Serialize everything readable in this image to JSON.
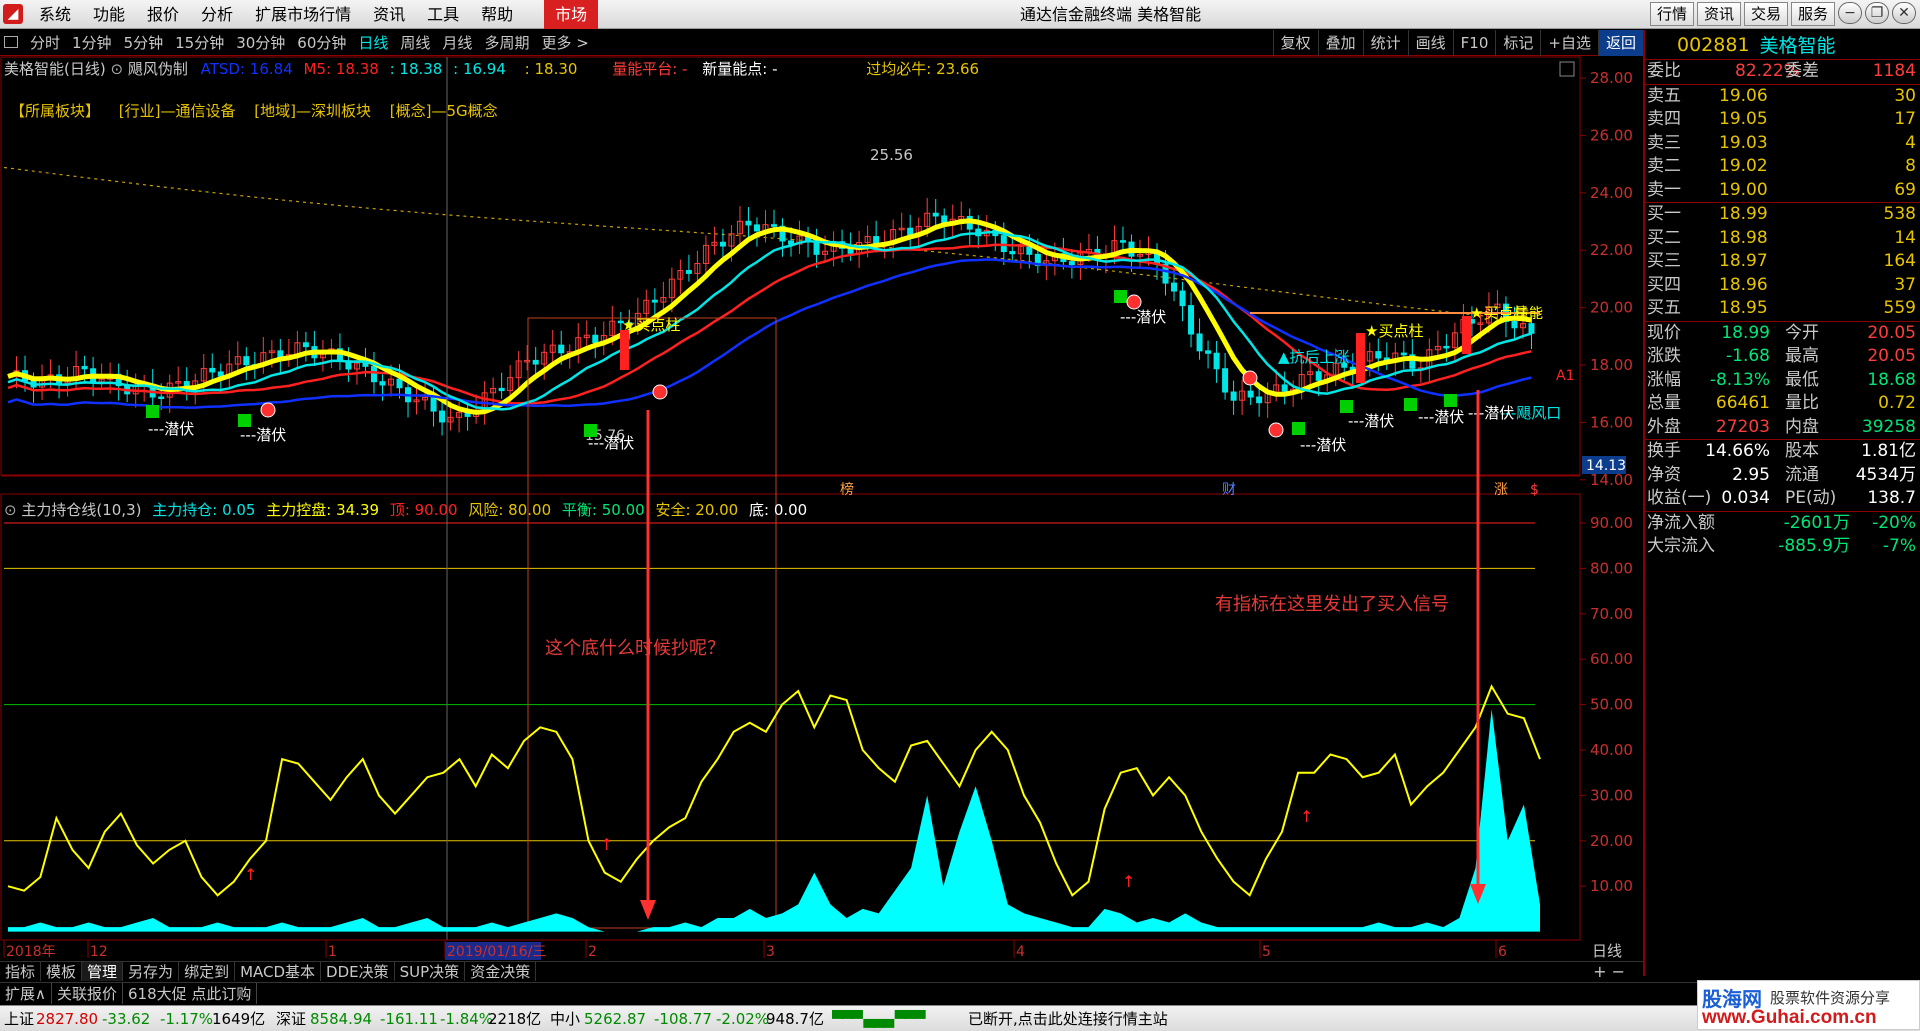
{
  "titlebar": {
    "menu": [
      "系统",
      "功能",
      "报价",
      "分析",
      "扩展市场行情",
      "资讯",
      "工具",
      "帮助"
    ],
    "active_menu": "市场",
    "window_title": "通达信金融终端  美格智能",
    "window_buttons": [
      "行情",
      "资讯",
      "交易",
      "服务"
    ]
  },
  "period_bar": {
    "periods": [
      "分时",
      "1分钟",
      "5分钟",
      "15分钟",
      "30分钟",
      "60分钟",
      "日线",
      "周线",
      "月线",
      "多周期",
      "更多 >"
    ],
    "selected": "日线",
    "tools": [
      "复权",
      "叠加",
      "统计",
      "画线",
      "F10",
      "标记",
      "+自选",
      "返回"
    ]
  },
  "main_header": {
    "name": "美格智能(日线)",
    "indicator": "飓风伪制",
    "atsd": "ATSD: 16.84",
    "m5": "M5: 18.38",
    "v1": ": 18.38",
    "v2": ": 16.94",
    "v3": ": 18.30",
    "platform": "量能平台: -",
    "new_point": "新量能点: -",
    "guojun": "过均必牛: 23.66"
  },
  "sectors": [
    "【所属板块】",
    "[行业]—通信设备",
    "[地域]—深圳板块",
    "[概念]—5G概念"
  ],
  "price_axis": [
    "28.00",
    "26.00",
    "24.00",
    "22.00",
    "20.00",
    "18.00",
    "16.00",
    "14.00"
  ],
  "price_marker": "14.13",
  "indicator_header": {
    "name": "主力持仓线(10,3)",
    "hold": "主力持仓: 0.05",
    "control": "主力控盘: 34.39",
    "top": "顶: 90.00",
    "risk": "风险: 80.00",
    "balance": "平衡: 50.00",
    "safe": "安全: 20.00",
    "bottom": "底: 0.00"
  },
  "indicator_axis": [
    "90.00",
    "80.00",
    "70.00",
    "60.00",
    "50.00",
    "40.00",
    "30.00",
    "20.00",
    "10.00"
  ],
  "annotations": {
    "question": "这个底什么时候抄呢？",
    "signal": "有指标在这里发出了买入信号"
  },
  "chart_labels": {
    "peak": "25.56",
    "low": "15.76",
    "buy_column": "★买点柱",
    "resist_rise": "▲抗后上涨",
    "qianfu": "---潜伏",
    "hurricane": "---飓风口",
    "liangneng": "量能",
    "a1": "A1",
    "bang": "榜",
    "cai": "财",
    "zhang": "涨",
    "dollar": "$"
  },
  "x_axis": [
    "2018年",
    "12",
    "1",
    "2019/01/16/三",
    "2",
    "3",
    "4",
    "5",
    "6"
  ],
  "x_axis_right": "日线",
  "quote": {
    "code": "002881",
    "name": "美格智能",
    "weibi_label": "委比",
    "weibi": "82.22%",
    "weicha_label": "委差",
    "weicha": "1184",
    "asks": [
      {
        "label": "卖五",
        "price": "19.06",
        "vol": "30"
      },
      {
        "label": "卖四",
        "price": "19.05",
        "vol": "17"
      },
      {
        "label": "卖三",
        "price": "19.03",
        "vol": "4"
      },
      {
        "label": "卖二",
        "price": "19.02",
        "vol": "8"
      },
      {
        "label": "卖一",
        "price": "19.00",
        "vol": "69"
      }
    ],
    "bids": [
      {
        "label": "买一",
        "price": "18.99",
        "vol": "538"
      },
      {
        "label": "买二",
        "price": "18.98",
        "vol": "14"
      },
      {
        "label": "买三",
        "price": "18.97",
        "vol": "164"
      },
      {
        "label": "买四",
        "price": "18.96",
        "vol": "37"
      },
      {
        "label": "买五",
        "price": "18.95",
        "vol": "559"
      }
    ],
    "stats": [
      {
        "l1": "现价",
        "v1": "18.99",
        "c1": "green",
        "l2": "今开",
        "v2": "20.05",
        "c2": "red"
      },
      {
        "l1": "涨跌",
        "v1": "-1.68",
        "c1": "green",
        "l2": "最高",
        "v2": "20.05",
        "c2": "red"
      },
      {
        "l1": "涨幅",
        "v1": "-8.13%",
        "c1": "green",
        "l2": "最低",
        "v2": "18.68",
        "c2": "green"
      },
      {
        "l1": "总量",
        "v1": "66461",
        "c1": "yellow",
        "l2": "量比",
        "v2": "0.72",
        "c2": "yellow"
      },
      {
        "l1": "外盘",
        "v1": "27203",
        "c1": "red",
        "l2": "内盘",
        "v2": "39258",
        "c2": "green"
      }
    ],
    "stats2": [
      {
        "l1": "换手",
        "v1": "14.66%",
        "l2": "股本",
        "v2": "1.81亿"
      },
      {
        "l1": "净资",
        "v1": "2.95",
        "l2": "流通",
        "v2": "4534万"
      },
      {
        "l1": "收益(一)",
        "v1": "0.034",
        "l2": "PE(动)",
        "v2": "138.7"
      }
    ],
    "flows": [
      {
        "label": "净流入额",
        "v1": "-2601万",
        "v2": "-20%"
      },
      {
        "label": "大宗流入",
        "v1": "-885.9万",
        "v2": "-7%"
      }
    ]
  },
  "tabs": [
    "指标",
    "模板",
    "管理",
    "另存为",
    "绑定到",
    "MACD基本",
    "DDE决策",
    "SUP决策",
    "资金决策"
  ],
  "selected_tab": "管理",
  "zoom": "+   −",
  "ext_bar": [
    "扩展∧",
    "关联报价",
    "618大促 点此订购"
  ],
  "status": {
    "sh_label": "上证",
    "sh_val": "2827.80",
    "sh_chg": "-33.62",
    "sh_pct": "-1.17%",
    "sh_amt": "1649亿",
    "sz_label": "深证",
    "sz_val": "8584.94",
    "sz_chg": "-161.11",
    "sz_pct": "-1.84%",
    "sz_amt": "2218亿",
    "zx_label": "中小",
    "zx_val": "5262.87",
    "zx_chg": "-108.77",
    "zx_pct": "-2.02%",
    "zx_amt": "948.7亿",
    "message": "已断开,点击此处连接行情主站"
  },
  "watermark": {
    "brand": "股海网",
    "sub": "股票软件资源分享",
    "url": "www.Guhai.com.cn"
  },
  "colors": {
    "up": "#ff3c3c",
    "down": "#00e6e6",
    "bar_fill": "#00ffff",
    "ma_yellow": "#ffff00",
    "ma_red": "#ff2020",
    "ma_blue": "#1030ff",
    "grid": "#8b0000"
  }
}
